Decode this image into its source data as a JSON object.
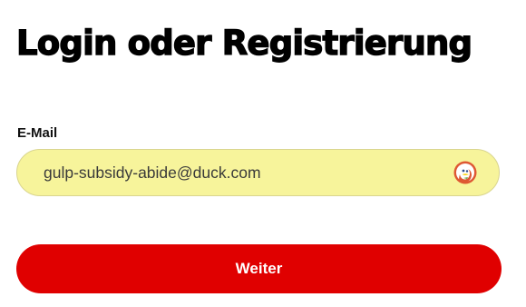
{
  "heading": "Login oder Registrierung",
  "email": {
    "label": "E-Mail",
    "value": "gulp-subsidy-abide@duck.com",
    "autofill_icon": "duckduckgo-icon"
  },
  "submit_label": "Weiter",
  "colors": {
    "button": "#e00000",
    "field_background": "#f7f49b",
    "duck_orange": "#de5833"
  }
}
